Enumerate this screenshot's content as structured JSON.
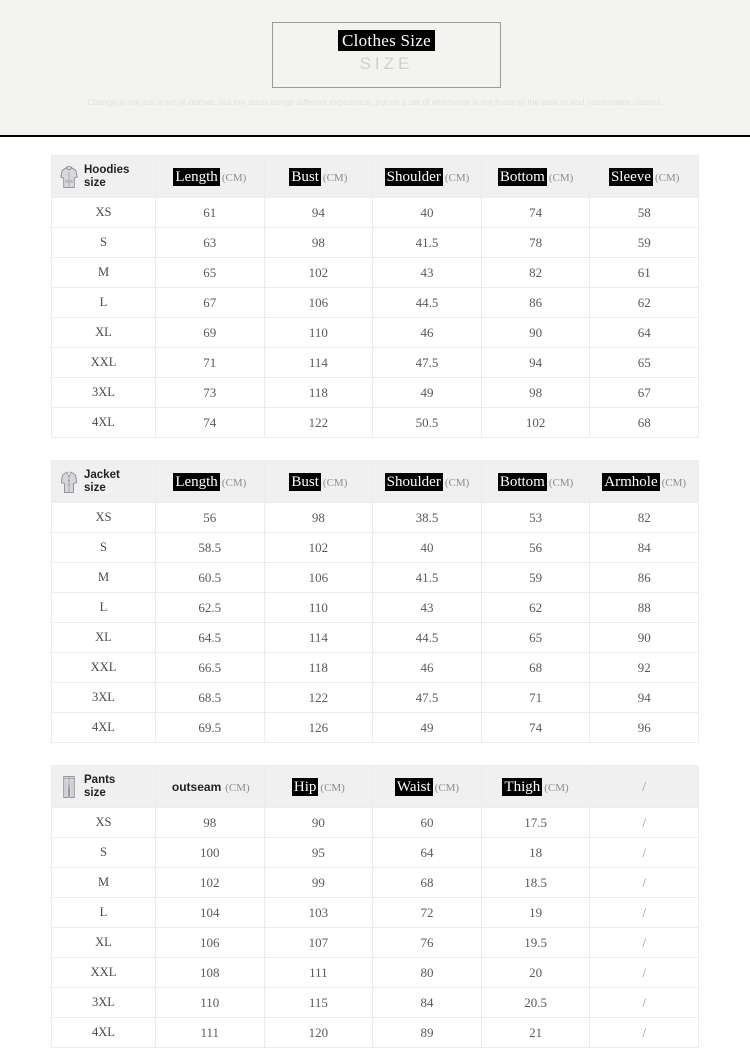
{
  "banner": {
    "title": "Clothes Size",
    "subtitle": "SIZE",
    "description": "Change is not just a set of clothes, but the dress brings\ndifferent experience, put on a set of whichever is the focus of the walk to and comfortable clothes.",
    "background_color": "#f3f4ef",
    "divider_color": "#000000"
  },
  "tables": [
    {
      "category_label": "Hoodies\nsize",
      "category_icon": "hoodie-icon",
      "columns": [
        {
          "name": "Length",
          "unit": "(CM)",
          "highlighted": true
        },
        {
          "name": "Bust",
          "unit": "(CM)",
          "highlighted": true
        },
        {
          "name": "Shoulder",
          "unit": "(CM)",
          "highlighted": true
        },
        {
          "name": "Bottom",
          "unit": "(CM)",
          "highlighted": true
        },
        {
          "name": "Sleeve",
          "unit": "(CM)",
          "highlighted": true
        }
      ],
      "rows": [
        {
          "size": "XS",
          "values": [
            "61",
            "94",
            "40",
            "74",
            "58"
          ]
        },
        {
          "size": "S",
          "values": [
            "63",
            "98",
            "41.5",
            "78",
            "59"
          ]
        },
        {
          "size": "M",
          "values": [
            "65",
            "102",
            "43",
            "82",
            "61"
          ]
        },
        {
          "size": "L",
          "values": [
            "67",
            "106",
            "44.5",
            "86",
            "62"
          ]
        },
        {
          "size": "XL",
          "values": [
            "69",
            "110",
            "46",
            "90",
            "64"
          ]
        },
        {
          "size": "XXL",
          "values": [
            "71",
            "114",
            "47.5",
            "94",
            "65"
          ]
        },
        {
          "size": "3XL",
          "values": [
            "73",
            "118",
            "49",
            "98",
            "67"
          ]
        },
        {
          "size": "4XL",
          "values": [
            "74",
            "122",
            "50.5",
            "102",
            "68"
          ]
        }
      ]
    },
    {
      "category_label": "Jacket\nsize",
      "category_icon": "jacket-icon",
      "columns": [
        {
          "name": "Length",
          "unit": "(CM)",
          "highlighted": true
        },
        {
          "name": "Bust",
          "unit": "(CM)",
          "highlighted": true
        },
        {
          "name": "Shoulder",
          "unit": "(CM)",
          "highlighted": true
        },
        {
          "name": "Bottom",
          "unit": "(CM)",
          "highlighted": true
        },
        {
          "name": "Armhole",
          "unit": "(CM)",
          "highlighted": true
        }
      ],
      "rows": [
        {
          "size": "XS",
          "values": [
            "56",
            "98",
            "38.5",
            "53",
            "82"
          ]
        },
        {
          "size": "S",
          "values": [
            "58.5",
            "102",
            "40",
            "56",
            "84"
          ]
        },
        {
          "size": "M",
          "values": [
            "60.5",
            "106",
            "41.5",
            "59",
            "86"
          ]
        },
        {
          "size": "L",
          "values": [
            "62.5",
            "110",
            "43",
            "62",
            "88"
          ]
        },
        {
          "size": "XL",
          "values": [
            "64.5",
            "114",
            "44.5",
            "65",
            "90"
          ]
        },
        {
          "size": "XXL",
          "values": [
            "66.5",
            "118",
            "46",
            "68",
            "92"
          ]
        },
        {
          "size": "3XL",
          "values": [
            "68.5",
            "122",
            "47.5",
            "71",
            "94"
          ]
        },
        {
          "size": "4XL",
          "values": [
            "69.5",
            "126",
            "49",
            "74",
            "96"
          ]
        }
      ]
    },
    {
      "category_label": "Pants\nsize",
      "category_icon": "pants-icon",
      "columns": [
        {
          "name": "outseam",
          "unit": "(CM)",
          "highlighted": false
        },
        {
          "name": "Hip",
          "unit": "(CM)",
          "highlighted": true
        },
        {
          "name": "Waist",
          "unit": "(CM)",
          "highlighted": true
        },
        {
          "name": "Thigh",
          "unit": "(CM)",
          "highlighted": true
        },
        {
          "name": "/",
          "unit": "",
          "highlighted": false
        }
      ],
      "rows": [
        {
          "size": "XS",
          "values": [
            "98",
            "90",
            "60",
            "17.5",
            "/"
          ]
        },
        {
          "size": "S",
          "values": [
            "100",
            "95",
            "64",
            "18",
            "/"
          ]
        },
        {
          "size": "M",
          "values": [
            "102",
            "99",
            "68",
            "18.5",
            "/"
          ]
        },
        {
          "size": "L",
          "values": [
            "104",
            "103",
            "72",
            "19",
            "/"
          ]
        },
        {
          "size": "XL",
          "values": [
            "106",
            "107",
            "76",
            "19.5",
            "/"
          ]
        },
        {
          "size": "XXL",
          "values": [
            "108",
            "111",
            "80",
            "20",
            "/"
          ]
        },
        {
          "size": "3XL",
          "values": [
            "110",
            "115",
            "84",
            "20.5",
            "/"
          ]
        },
        {
          "size": "4XL",
          "values": [
            "111",
            "120",
            "89",
            "21",
            "/"
          ]
        }
      ]
    }
  ]
}
